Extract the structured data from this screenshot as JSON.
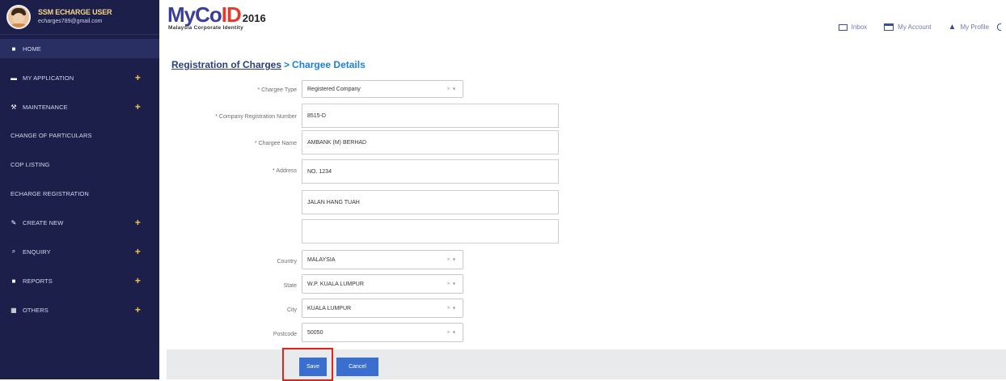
{
  "user": {
    "name": "SSM ECHARGE USER",
    "email": "echarges789@gmail.com"
  },
  "sidebar": {
    "items": [
      {
        "label": "HOME",
        "icon": "home-icon",
        "glyph": "■",
        "expandable": false
      },
      {
        "label": "MY APPLICATION",
        "icon": "list-icon",
        "glyph": "▬",
        "expandable": true
      },
      {
        "label": "MAINTENANCE",
        "icon": "wrench-icon",
        "glyph": "⚒",
        "expandable": true
      },
      {
        "label": "CHANGE OF PARTICULARS",
        "icon": "",
        "glyph": "",
        "expandable": false
      },
      {
        "label": "COP LISTING",
        "icon": "",
        "glyph": "",
        "expandable": false
      },
      {
        "label": "ECHARGE REGISTRATION",
        "icon": "",
        "glyph": "",
        "expandable": false
      },
      {
        "label": "CREATE NEW",
        "icon": "edit-icon",
        "glyph": "✎",
        "expandable": true
      },
      {
        "label": "ENQUIRY",
        "icon": "search-icon",
        "glyph": "⌕",
        "expandable": true
      },
      {
        "label": "REPORTS",
        "icon": "file-icon",
        "glyph": "■",
        "expandable": true
      },
      {
        "label": "OTHERS",
        "icon": "grid-icon",
        "glyph": "▦",
        "expandable": true
      }
    ],
    "plus": "+"
  },
  "logo": {
    "main_prefix": "MyCo",
    "main_id": "ID",
    "year": "2016",
    "subtitle": "Malaysia Corporate Identity"
  },
  "header": {
    "inbox": "Inbox",
    "my_account": "My Account",
    "my_profile": "My Profile"
  },
  "breadcrumb": {
    "root": "Registration of Charges",
    "separator": ">",
    "current": "Chargee Details"
  },
  "form": {
    "chargee_type_label": "* Chargee Type",
    "chargee_type_value": "Registered Company",
    "company_reg_label": "* Company Registration Number",
    "company_reg_value": "8515-D",
    "chargee_name_label": "* Chargee Name",
    "chargee_name_value": "AMBANK (M) BERHAD",
    "address_label": "* Address",
    "address_line1": "NO. 1234",
    "address_line2": "JALAN HANG TUAH",
    "address_line3": "",
    "country_label": "Country",
    "country_value": "MALAYSIA",
    "state_label": "State",
    "state_value": "W.P. KUALA LUMPUR",
    "city_label": "City",
    "city_value": "KUALA LUMPUR",
    "postcode_label": "Postcode",
    "postcode_value": "50050",
    "select_caret": "× ▾"
  },
  "actions": {
    "save": "Save",
    "cancel": "Cancel"
  },
  "colors": {
    "sidebar_bg": "#1b1f4a",
    "accent": "#1e7fd9",
    "button": "#3a6fd0",
    "highlight": "#e2231a",
    "plus": "#f0c94a"
  }
}
